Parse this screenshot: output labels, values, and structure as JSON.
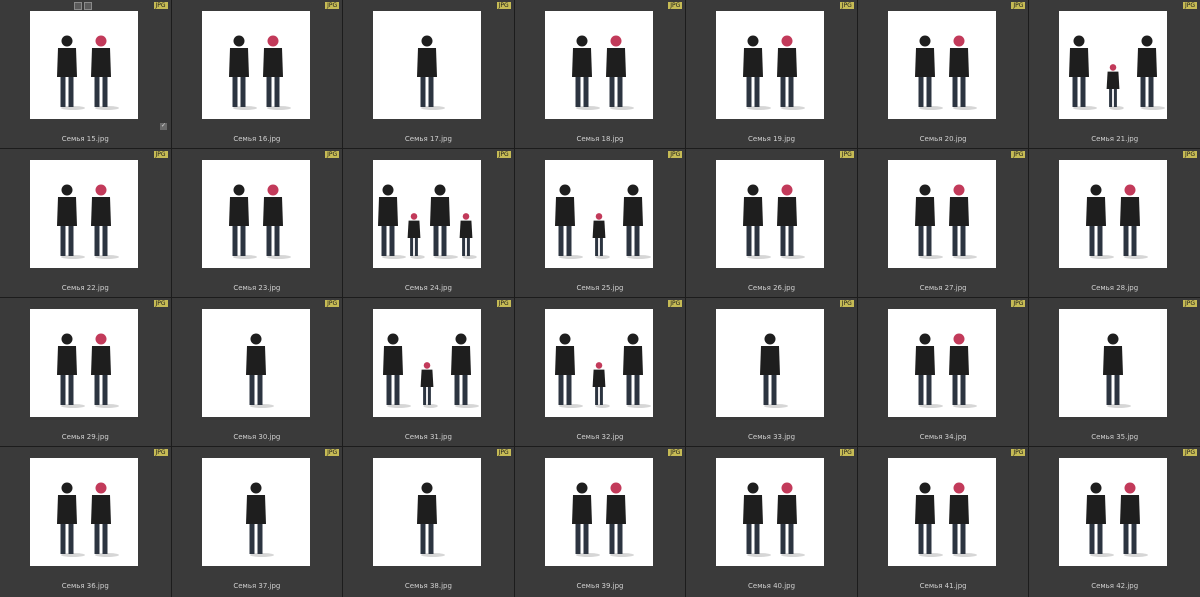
{
  "badge_label": "JPG",
  "thumbnails": [
    {
      "filename": "Семья 15.jpg",
      "people": 2
    },
    {
      "filename": "Семья 16.jpg",
      "people": 2
    },
    {
      "filename": "Семья 17.jpg",
      "people": 1
    },
    {
      "filename": "Семья 18.jpg",
      "people": 2
    },
    {
      "filename": "Семья 19.jpg",
      "people": 2
    },
    {
      "filename": "Семья 20.jpg",
      "people": 2
    },
    {
      "filename": "Семья 21.jpg",
      "people": 3
    },
    {
      "filename": "Семья 22.jpg",
      "people": 2
    },
    {
      "filename": "Семья 23.jpg",
      "people": 2
    },
    {
      "filename": "Семья 24.jpg",
      "people": 4
    },
    {
      "filename": "Семья 25.jpg",
      "people": 3
    },
    {
      "filename": "Семья 26.jpg",
      "people": 2
    },
    {
      "filename": "Семья 27.jpg",
      "people": 2
    },
    {
      "filename": "Семья 28.jpg",
      "people": 2
    },
    {
      "filename": "Семья 29.jpg",
      "people": 2
    },
    {
      "filename": "Семья 30.jpg",
      "people": 1
    },
    {
      "filename": "Семья 31.jpg",
      "people": 3
    },
    {
      "filename": "Семья 32.jpg",
      "people": 3
    },
    {
      "filename": "Семья 33.jpg",
      "people": 1
    },
    {
      "filename": "Семья 34.jpg",
      "people": 2
    },
    {
      "filename": "Семья 35.jpg",
      "people": 1
    },
    {
      "filename": "Семья 36.jpg",
      "people": 2
    },
    {
      "filename": "Семья 37.jpg",
      "people": 1
    },
    {
      "filename": "Семья 38.jpg",
      "people": 1
    },
    {
      "filename": "Семья 39.jpg",
      "people": 2
    },
    {
      "filename": "Семья 40.jpg",
      "people": 2
    },
    {
      "filename": "Семья 41.jpg",
      "people": 2
    },
    {
      "filename": "Семья 42.jpg",
      "people": 2
    }
  ],
  "colors": {
    "grid_line": "#1c1c1c",
    "cell_bg": "#3a3a3a",
    "badge_bg": "#c6bb55",
    "thumb_bg": "#ffffff",
    "filename_text": "#cfcfcf",
    "figure_dark": "#1e1e1e",
    "figure_accent": "#c23a5a"
  },
  "icons": {
    "checkbox": "checkbox-icon",
    "rating": "rating-icon",
    "badge": "file-type-badge"
  }
}
